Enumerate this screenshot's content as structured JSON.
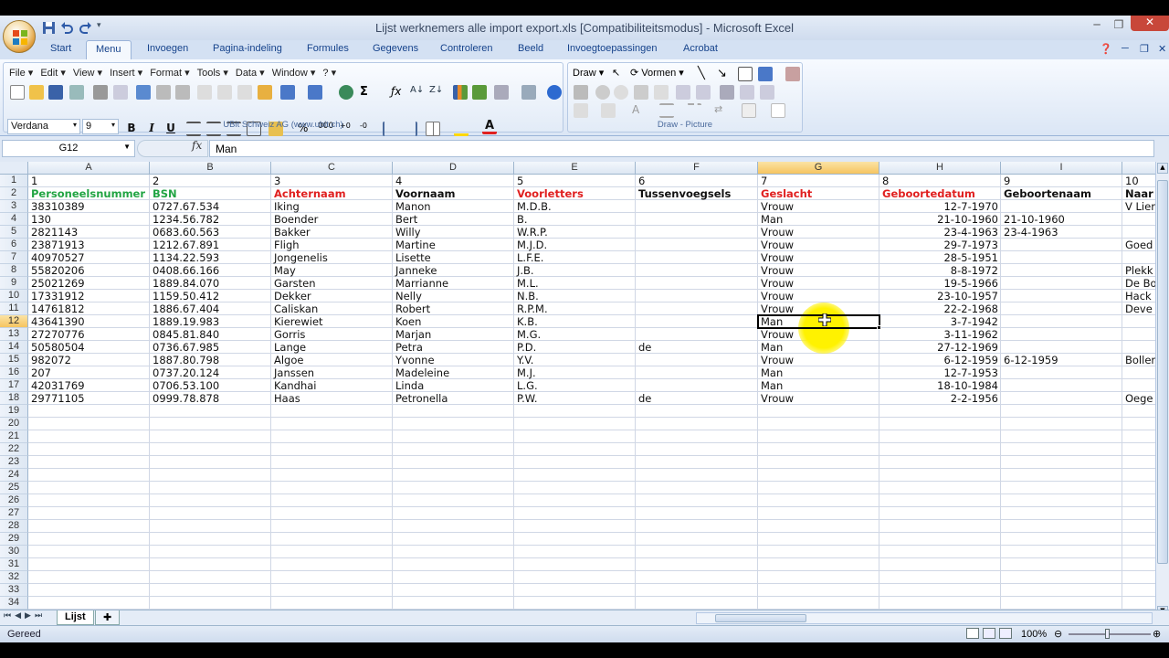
{
  "window": {
    "title": "Lijst werknemers  alle  import export.xls  [Compatibiliteitsmodus] - Microsoft Excel"
  },
  "tabs": [
    "Start",
    "Menu",
    "Invoegen",
    "Pagina-indeling",
    "Formules",
    "Gegevens",
    "Controleren",
    "Beeld",
    "Invoegtoepassingen",
    "Acrobat"
  ],
  "active_tab": "Menu",
  "menu_bar": [
    "File ▾",
    "Edit ▾",
    "View ▾",
    "Insert ▾",
    "Format ▾",
    "Tools ▾",
    "Data ▾",
    "Window ▾",
    "? ▾"
  ],
  "font": {
    "name": "Verdana",
    "size": "9"
  },
  "ribbon_group_label": "UBit Schweiz AG    (www.ubit.ch)",
  "draw": {
    "draw_label": "Draw",
    "vormen_label": "Vormen",
    "group_label": "Draw - Picture"
  },
  "formula": {
    "name_box": "G12",
    "fx": "fx",
    "value": "Man"
  },
  "columns": [
    "A",
    "B",
    "C",
    "D",
    "E",
    "F",
    "G",
    "H",
    "I",
    ""
  ],
  "selected_column": "G",
  "selected_row": "12",
  "row_numbers": [
    "1",
    "2",
    "3",
    "4",
    "5",
    "6",
    "7",
    "8",
    "9",
    "10",
    "11",
    "12",
    "13",
    "14",
    "15",
    "16",
    "17",
    "18",
    "19",
    "20",
    "21",
    "22",
    "23",
    "24",
    "25",
    "26",
    "27",
    "28",
    "29",
    "30",
    "31",
    "32",
    "33",
    "34"
  ],
  "header_numbers": [
    "1",
    "2",
    "3",
    "4",
    "5",
    "6",
    "7",
    "8",
    "9",
    "10"
  ],
  "headers": [
    {
      "text": "Personeelsnummer",
      "color": "#22a544"
    },
    {
      "text": "BSN",
      "color": "#22a544"
    },
    {
      "text": "Achternaam",
      "color": "#e02020"
    },
    {
      "text": "Voornaam",
      "color": "#111111"
    },
    {
      "text": "Voorletters",
      "color": "#e02020"
    },
    {
      "text": "Tussenvoegsels",
      "color": "#111111"
    },
    {
      "text": "Geslacht",
      "color": "#e02020"
    },
    {
      "text": "Geboortedatum",
      "color": "#e02020"
    },
    {
      "text": "Geboortenaam",
      "color": "#111111"
    },
    {
      "text": "Naar",
      "color": "#111111"
    }
  ],
  "rows": [
    [
      "38310389",
      "0727.67.534",
      "Iking",
      "Manon",
      "M.D.B.",
      "",
      "Vrouw",
      "12-7-1970",
      "",
      "V Lier"
    ],
    [
      "130",
      "1234.56.782",
      "Boender",
      "Bert",
      "B.",
      "",
      "Man",
      "21-10-1960",
      "21-10-1960",
      ""
    ],
    [
      "2821143",
      "0683.60.563",
      "Bakker",
      "Willy",
      "W.R.P.",
      "",
      "Vrouw",
      "23-4-1963",
      "23-4-1963",
      ""
    ],
    [
      "23871913",
      "1212.67.891",
      "Fligh",
      "Martine",
      "M.J.D.",
      "",
      "Vrouw",
      "29-7-1973",
      "",
      "Goed"
    ],
    [
      "40970527",
      "1134.22.593",
      "Jongenelis",
      "Lisette",
      "L.F.E.",
      "",
      "Vrouw",
      "28-5-1951",
      "",
      ""
    ],
    [
      "55820206",
      "0408.66.166",
      "May",
      "Janneke",
      "J.B.",
      "",
      "Vrouw",
      "8-8-1972",
      "",
      "Plekk"
    ],
    [
      "25021269",
      "1889.84.070",
      "Garsten",
      "Marrianne",
      "M.L.",
      "",
      "Vrouw",
      "19-5-1966",
      "",
      "De Bo"
    ],
    [
      "17331912",
      "1159.50.412",
      "Dekker",
      "Nelly",
      "N.B.",
      "",
      "Vrouw",
      "23-10-1957",
      "",
      "Hack"
    ],
    [
      "14761812",
      "1886.67.404",
      "Caliskan",
      "Robert",
      "R.P.M.",
      "",
      "Vrouw",
      "22-2-1968",
      "",
      "Deve"
    ],
    [
      "43641390",
      "1889.19.983",
      "Kierewiet",
      "Koen",
      "K.B.",
      "",
      "Man",
      "3-7-1942",
      "",
      ""
    ],
    [
      "27270776",
      "0845.81.840",
      "Gorris",
      "Marjan",
      "M.G.",
      "",
      "Vrouw",
      "3-11-1962",
      "",
      ""
    ],
    [
      "50580504",
      "0736.67.985",
      "Lange",
      "Petra",
      "P.D.",
      "de",
      "Man",
      "27-12-1969",
      "",
      ""
    ],
    [
      "982072",
      "1887.80.798",
      "Algoe",
      "Yvonne",
      "Y.V.",
      "",
      "Vrouw",
      "6-12-1959",
      "6-12-1959",
      "Boller"
    ],
    [
      "207",
      "0737.20.124",
      "Janssen",
      "Madeleine",
      "M.J.",
      "",
      "Man",
      "12-7-1953",
      "",
      ""
    ],
    [
      "42031769",
      "0706.53.100",
      "Kandhai",
      "Linda",
      "L.G.",
      "",
      "Man",
      "18-10-1984",
      "",
      ""
    ],
    [
      "29771105",
      "0999.78.878",
      "Haas",
      "Petronella",
      "P.W.",
      "de",
      "Vrouw",
      "2-2-1956",
      "",
      "Oege"
    ]
  ],
  "sheet_tab": "Lijst",
  "status": {
    "text": "Gereed",
    "zoom": "100%"
  }
}
